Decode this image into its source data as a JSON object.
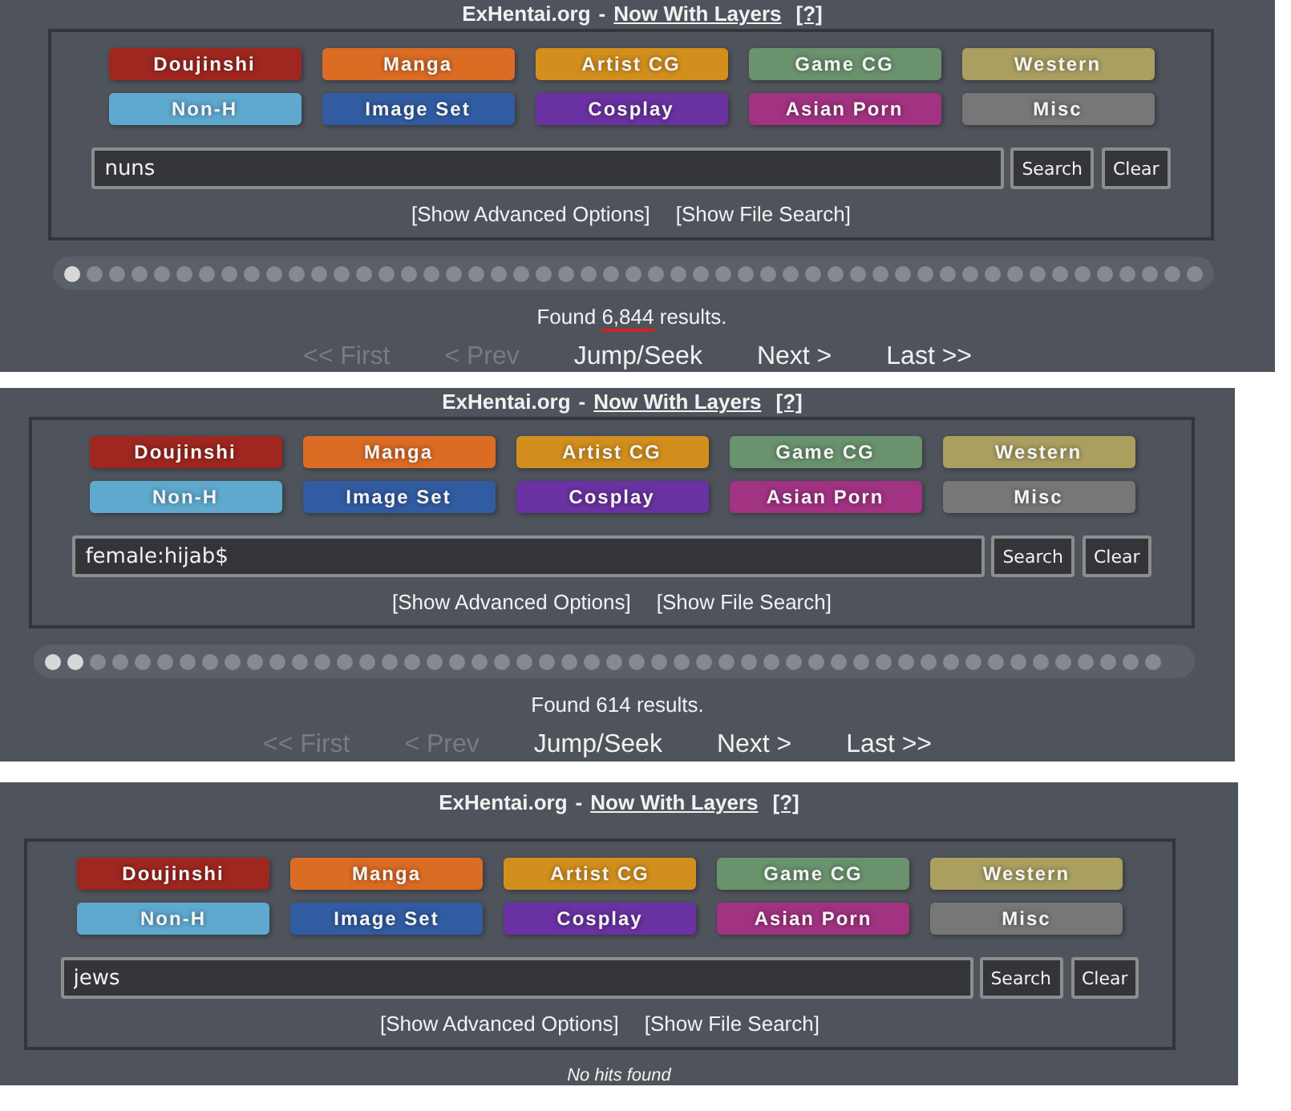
{
  "panels": [
    {
      "title": {
        "site": "ExHentai.org",
        "separator": "-",
        "link": "Now With Layers",
        "help": "[?]"
      },
      "categories": [
        {
          "label": "Doujinshi",
          "color": "#9e2720"
        },
        {
          "label": "Manga",
          "color": "#db6c24"
        },
        {
          "label": "Artist CG",
          "color": "#d38f1d"
        },
        {
          "label": "Game CG",
          "color": "#6a936d"
        },
        {
          "label": "Western",
          "color": "#ab9f60"
        },
        {
          "label": "Non-H",
          "color": "#5fa9cf"
        },
        {
          "label": "Image Set",
          "color": "#325ca2"
        },
        {
          "label": "Cosplay",
          "color": "#6a32a2"
        },
        {
          "label": "Asian Porn",
          "color": "#a23282"
        },
        {
          "label": "Misc",
          "color": "#777777"
        }
      ],
      "search": {
        "value": "nuns",
        "search_button": "Search",
        "clear_button": "Clear"
      },
      "links": [
        "[Show Advanced Options]",
        "[Show File Search]"
      ],
      "dots": [
        {
          "lit": true
        },
        {
          "lit": false
        },
        {
          "lit": false
        },
        {
          "lit": false
        },
        {
          "lit": false
        },
        {
          "lit": false
        },
        {
          "lit": false
        },
        {
          "lit": false
        },
        {
          "lit": false
        },
        {
          "lit": false
        },
        {
          "lit": false
        },
        {
          "lit": false
        },
        {
          "lit": false
        },
        {
          "lit": false
        },
        {
          "lit": false
        },
        {
          "lit": false
        },
        {
          "lit": false
        },
        {
          "lit": false
        },
        {
          "lit": false
        },
        {
          "lit": false
        },
        {
          "lit": false
        },
        {
          "lit": false
        },
        {
          "lit": false
        },
        {
          "lit": false
        },
        {
          "lit": false
        },
        {
          "lit": false
        },
        {
          "lit": false
        },
        {
          "lit": false
        },
        {
          "lit": false
        },
        {
          "lit": false
        },
        {
          "lit": false
        },
        {
          "lit": false
        },
        {
          "lit": false
        },
        {
          "lit": false
        },
        {
          "lit": false
        },
        {
          "lit": false
        },
        {
          "lit": false
        },
        {
          "lit": false
        },
        {
          "lit": false
        },
        {
          "lit": false
        },
        {
          "lit": false
        },
        {
          "lit": false
        },
        {
          "lit": false
        },
        {
          "lit": false
        },
        {
          "lit": false
        },
        {
          "lit": false
        },
        {
          "lit": false
        },
        {
          "lit": false
        },
        {
          "lit": false
        },
        {
          "lit": false
        },
        {
          "lit": false
        }
      ],
      "result": {
        "kind": "count",
        "before": "Found ",
        "number": "6,844",
        "after": " results.",
        "marked": true
      },
      "pager": [
        {
          "label": "<< First",
          "disabled": true
        },
        {
          "label": "< Prev",
          "disabled": true
        },
        {
          "label": "Jump/Seek",
          "disabled": false
        },
        {
          "label": "Next >",
          "disabled": false
        },
        {
          "label": "Last >>",
          "disabled": false
        }
      ]
    },
    {
      "title": {
        "site": "ExHentai.org",
        "separator": "-",
        "link": "Now With Layers",
        "help": "[?]"
      },
      "categories": [
        {
          "label": "Doujinshi",
          "color": "#9e2720"
        },
        {
          "label": "Manga",
          "color": "#db6c24"
        },
        {
          "label": "Artist CG",
          "color": "#d38f1d"
        },
        {
          "label": "Game CG",
          "color": "#6a936d"
        },
        {
          "label": "Western",
          "color": "#ab9f60"
        },
        {
          "label": "Non-H",
          "color": "#5fa9cf"
        },
        {
          "label": "Image Set",
          "color": "#325ca2"
        },
        {
          "label": "Cosplay",
          "color": "#6a32a2"
        },
        {
          "label": "Asian Porn",
          "color": "#a23282"
        },
        {
          "label": "Misc",
          "color": "#777777"
        }
      ],
      "search": {
        "value": "female:hijab$",
        "search_button": "Search",
        "clear_button": "Clear"
      },
      "links": [
        "[Show Advanced Options]",
        "[Show File Search]"
      ],
      "dots": [
        {
          "lit": true
        },
        {
          "lit": true
        },
        {
          "lit": false
        },
        {
          "lit": false
        },
        {
          "lit": false
        },
        {
          "lit": false
        },
        {
          "lit": false
        },
        {
          "lit": false
        },
        {
          "lit": false
        },
        {
          "lit": false
        },
        {
          "lit": false
        },
        {
          "lit": false
        },
        {
          "lit": false
        },
        {
          "lit": false
        },
        {
          "lit": false
        },
        {
          "lit": false
        },
        {
          "lit": false
        },
        {
          "lit": false
        },
        {
          "lit": false
        },
        {
          "lit": false
        },
        {
          "lit": false
        },
        {
          "lit": false
        },
        {
          "lit": false
        },
        {
          "lit": false
        },
        {
          "lit": false
        },
        {
          "lit": false
        },
        {
          "lit": false
        },
        {
          "lit": false
        },
        {
          "lit": false
        },
        {
          "lit": false
        },
        {
          "lit": false
        },
        {
          "lit": false
        },
        {
          "lit": false
        },
        {
          "lit": false
        },
        {
          "lit": false
        },
        {
          "lit": false
        },
        {
          "lit": false
        },
        {
          "lit": false
        },
        {
          "lit": false
        },
        {
          "lit": false
        },
        {
          "lit": false
        },
        {
          "lit": false
        },
        {
          "lit": false
        },
        {
          "lit": false
        },
        {
          "lit": false
        },
        {
          "lit": false
        },
        {
          "lit": false
        },
        {
          "lit": false
        },
        {
          "lit": false
        },
        {
          "lit": false
        }
      ],
      "result": {
        "kind": "count",
        "before": "Found ",
        "number": "614",
        "after": " results.",
        "marked": false
      },
      "pager": [
        {
          "label": "<< First",
          "disabled": true
        },
        {
          "label": "< Prev",
          "disabled": true
        },
        {
          "label": "Jump/Seek",
          "disabled": false
        },
        {
          "label": "Next >",
          "disabled": false
        },
        {
          "label": "Last >>",
          "disabled": false
        }
      ]
    },
    {
      "title": {
        "site": "ExHentai.org",
        "separator": "-",
        "link": "Now With Layers",
        "help": "[?]"
      },
      "categories": [
        {
          "label": "Doujinshi",
          "color": "#9e2720"
        },
        {
          "label": "Manga",
          "color": "#db6c24"
        },
        {
          "label": "Artist CG",
          "color": "#d38f1d"
        },
        {
          "label": "Game CG",
          "color": "#6a936d"
        },
        {
          "label": "Western",
          "color": "#ab9f60"
        },
        {
          "label": "Non-H",
          "color": "#5fa9cf"
        },
        {
          "label": "Image Set",
          "color": "#325ca2"
        },
        {
          "label": "Cosplay",
          "color": "#6a32a2"
        },
        {
          "label": "Asian Porn",
          "color": "#a23282"
        },
        {
          "label": "Misc",
          "color": "#777777"
        }
      ],
      "search": {
        "value": "jews",
        "search_button": "Search",
        "clear_button": "Clear"
      },
      "links": [
        "[Show Advanced Options]",
        "[Show File Search]"
      ],
      "result": {
        "kind": "none",
        "text": "No hits found"
      }
    }
  ]
}
